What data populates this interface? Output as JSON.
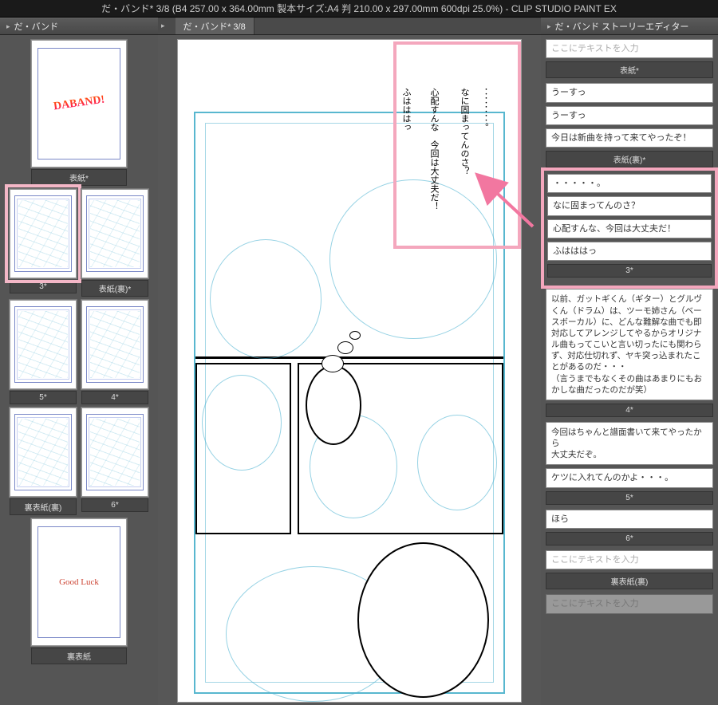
{
  "titlebar": "だ・バンド* 3/8 (B4 257.00 x 364.00mm 製本サイズ:A4 判 210.00 x 297.00mm 600dpi 25.0%)  - CLIP STUDIO PAINT EX",
  "left_panel": {
    "title": "だ・バンド",
    "pages": [
      {
        "label": "表紙*",
        "type": "cover",
        "art": "DABAND!"
      },
      {
        "label": "3*",
        "type": "sketch",
        "selected": true,
        "pair_with": "表紙(裏)*"
      },
      {
        "label": "表紙(裏)*",
        "type": "sketch"
      },
      {
        "label": "5*",
        "type": "sketch",
        "pair_with": "4*"
      },
      {
        "label": "4*",
        "type": "sketch"
      },
      {
        "label": "裏表紙(裏)",
        "type": "sketch",
        "pair_with": "6*"
      },
      {
        "label": "6*",
        "type": "sketch"
      },
      {
        "label": "裏表紙",
        "type": "back",
        "art": "Good Luck"
      }
    ]
  },
  "center": {
    "tab_label": "だ・バンド* 3/8",
    "vertical_text": {
      "a": "：：：：。",
      "b": "なに固まってんのさ？",
      "c": "心配すんな　今回は大丈夫だ！",
      "d": "ふはははっ"
    }
  },
  "right_panel": {
    "title": "だ・バンド ストーリーエディター",
    "placeholder": "ここにテキストを入力",
    "sections": [
      {
        "sep": "表紙*",
        "items": []
      },
      {
        "sep": "表紙(裏)*",
        "items": [
          "うーすっ",
          "うーすっ",
          "今日は新曲を持って来てやったぞ！"
        ]
      },
      {
        "sep": "3*",
        "highlighted": true,
        "items": [
          "・・・・・。",
          "なに固まってんのさ？",
          "心配すんな、今回は大丈夫だ！",
          "ふはははっ"
        ]
      },
      {
        "sep": "4*",
        "long": "以前、ガットギくん（ギター）とグルヴくん（ドラム）は、ツーモ姉さん（ベースボーカル）に、どんな難解な曲でも即対応してアレンジしてやるからオリジナル曲もってこいと言い切ったにも関わらず、対応仕切れず、ヤキ突っ込まれたことがあるのだ・・・\n（言うまでもなくその曲はあまりにもおかしな曲だったのだが笑）"
      },
      {
        "sep": "5*",
        "items": [
          "今回はちゃんと譜面書いて来てやったから\n大丈夫だぞ。",
          "ケツに入れてんのかよ・・・。"
        ]
      },
      {
        "sep": "6*",
        "items": [
          "ほら"
        ]
      },
      {
        "sep": "裏表紙(裏)",
        "items_placeholder": true
      }
    ]
  }
}
